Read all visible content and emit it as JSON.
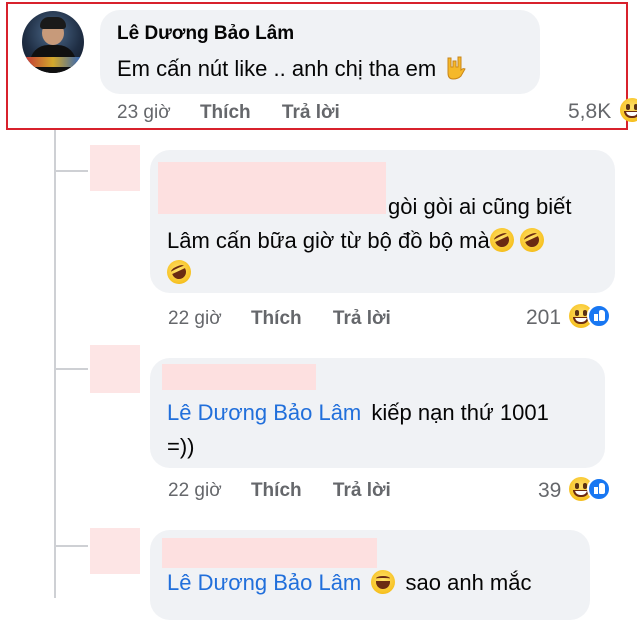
{
  "main_comment": {
    "author": "Lê Dương Bảo Lâm",
    "text": "Em cấn nút like .. anh chị tha em",
    "time": "23 giờ",
    "like_label": "Thích",
    "reply_label": "Trả lời",
    "reaction_count": "5,8K",
    "end_emoji": "rock-on-hand-icon"
  },
  "replies": [
    {
      "text_line1": "gòi gòi ai cũng biết",
      "text_line2": "Lâm cấn bữa giờ từ bộ đồ bộ mà",
      "time": "22 giờ",
      "like_label": "Thích",
      "reply_label": "Trả lời",
      "reaction_count": "201"
    },
    {
      "mention": "Lê Dương Bảo Lâm",
      "text_line1": "kiếp nạn thứ 1001",
      "text_line2": "=))",
      "time": "22 giờ",
      "like_label": "Thích",
      "reply_label": "Trả lời",
      "reaction_count": "39"
    },
    {
      "mention": "Lê Dương Bảo Lâm",
      "text_line1": "sao anh mắc"
    }
  ],
  "colors": {
    "highlight_border": "#d8212c",
    "bubble_bg": "#f0f2f5",
    "mention_link": "#216fdb",
    "meta_text": "#65676b"
  }
}
